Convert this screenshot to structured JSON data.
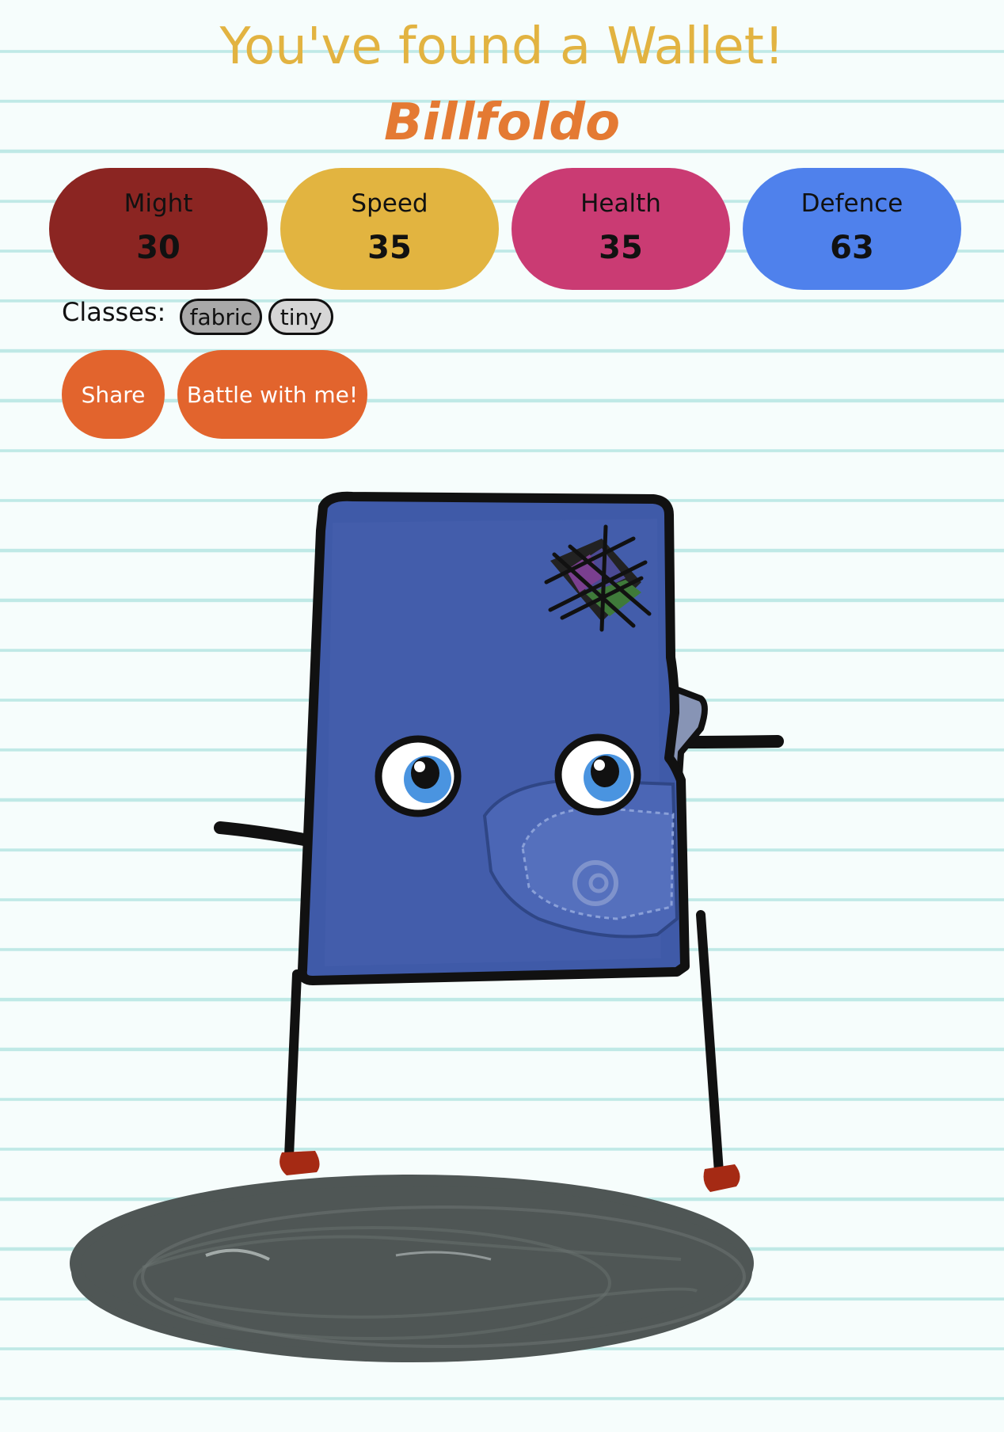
{
  "headline": "You've found a Wallet!",
  "creature_name": "Billfoldo",
  "stats": [
    {
      "label": "Might",
      "value": "30",
      "color": "#8b2522"
    },
    {
      "label": "Speed",
      "value": "35",
      "color": "#e2b440"
    },
    {
      "label": "Health",
      "value": "35",
      "color": "#ca3b73"
    },
    {
      "label": "Defence",
      "value": "63",
      "color": "#4f81ec"
    }
  ],
  "classes": {
    "label": "Classes:",
    "items": [
      "fabric",
      "tiny"
    ]
  },
  "actions": {
    "share_label": "Share",
    "battle_label": "Battle with me!"
  },
  "colors": {
    "paper": "#f6fdfc",
    "paper_lines": "#bfe9e6",
    "headline": "#e2b341",
    "name": "#e47a33",
    "button": "#e2642d",
    "wallet": "#3f5aa8",
    "shadow": "#4f5655",
    "feet": "#a52a14"
  },
  "icons": {
    "creature": "wallet-creature-illustration",
    "shadow": "scribble-shadow"
  }
}
